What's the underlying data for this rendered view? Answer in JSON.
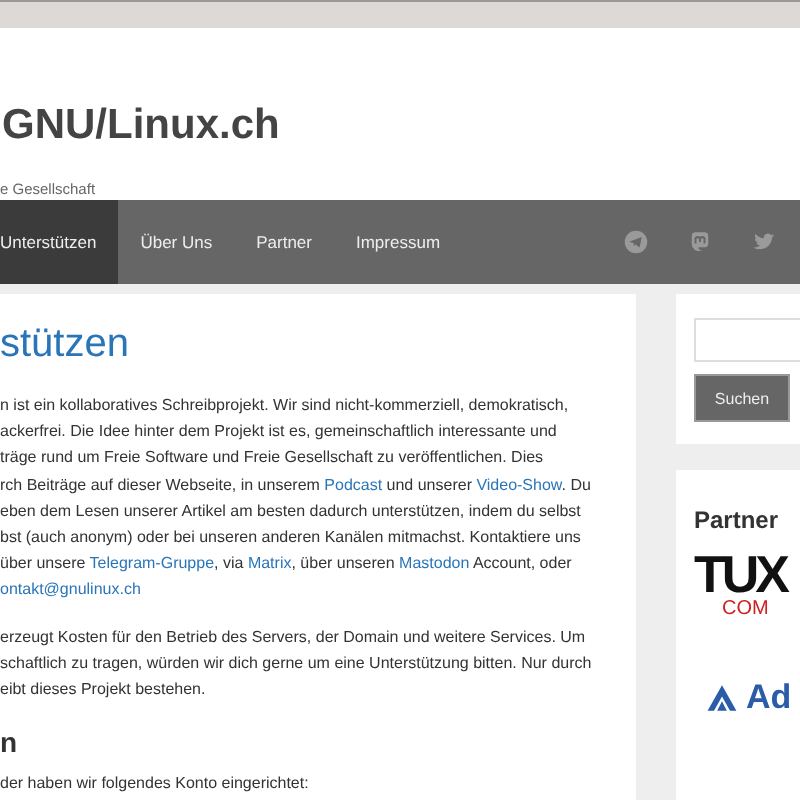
{
  "site": {
    "title": "GNU/Linux.ch",
    "tagline": "e Gesellschaft"
  },
  "nav": {
    "items": [
      {
        "label": "Unterstützen",
        "selected": true
      },
      {
        "label": "Über Uns",
        "selected": false
      },
      {
        "label": "Partner",
        "selected": false
      },
      {
        "label": "Impressum",
        "selected": false
      }
    ],
    "social": [
      {
        "kind": "telegram"
      },
      {
        "kind": "mastodon"
      },
      {
        "kind": "twitter"
      }
    ]
  },
  "article": {
    "title": "stützen",
    "paragraphs": [
      [
        [
          {
            "text": "n ist ein kollaboratives Schreibprojekt. Wir sind nicht-kommerziell, demokratisch,",
            "link": false
          }
        ],
        [
          {
            "text": "ackerfrei. Die Idee hinter dem Projekt ist es, gemeinschaftlich interessante und",
            "link": false
          }
        ],
        [
          {
            "text": "träge rund um Freie Software und Freie Gesellschaft zu veröffentlichen. Dies",
            "link": false
          }
        ],
        [
          {
            "text": "rch Beiträge auf dieser Webseite, in unserem ",
            "link": false
          },
          {
            "text": "Podcast",
            "link": true
          },
          {
            "text": " und unserer ",
            "link": false
          },
          {
            "text": "Video-Show",
            "link": true
          },
          {
            "text": ". Du",
            "link": false
          }
        ],
        [
          {
            "text": "eben dem Lesen unserer Artikel am besten dadurch unterstützen, indem du selbst",
            "link": false
          }
        ],
        [
          {
            "text": "bst (auch anonym) oder bei unseren anderen Kanälen mitmachst. Kontaktiere uns",
            "link": false
          }
        ],
        [
          {
            "text": "über unsere ",
            "link": false
          },
          {
            "text": "Telegram-Gruppe",
            "link": true
          },
          {
            "text": ", via ",
            "link": false
          },
          {
            "text": "Matrix",
            "link": true
          },
          {
            "text": ", über unseren ",
            "link": false
          },
          {
            "text": "Mastodon",
            "link": true
          },
          {
            "text": " Account, oder",
            "link": false
          }
        ],
        [
          {
            "text": "ontakt@gnulinux.ch",
            "link": true
          }
        ]
      ],
      [
        [
          {
            "text": "erzeugt Kosten für den Betrieb des Servers, der Domain und weitere Services. Um",
            "link": false
          }
        ],
        [
          {
            "text": "schaftlich zu tragen, würden wir dich gerne um eine Unterstützung bitten. Nur durch",
            "link": false
          }
        ],
        [
          {
            "text": "eibt dieses Projekt bestehen.",
            "link": false
          }
        ]
      ]
    ],
    "subheading": "n",
    "last_line": "der haben wir folgendes Konto eingerichtet:"
  },
  "sidebar": {
    "search": {
      "button": "Suchen"
    },
    "partner": {
      "title": "Partner",
      "logos": [
        {
          "kind": "tuxedo",
          "text": "TUX",
          "sub": "COM"
        },
        {
          "kind": "ad",
          "text": "Ad"
        }
      ]
    }
  }
}
